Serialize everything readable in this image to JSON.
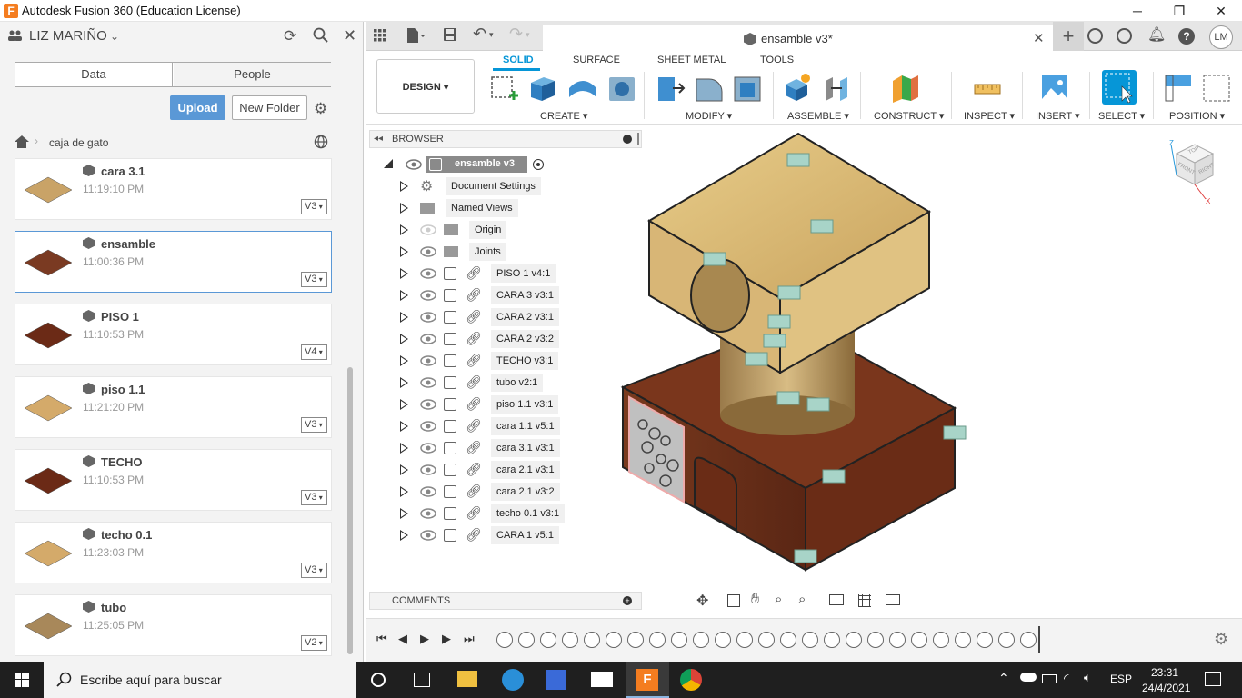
{
  "window": {
    "title": "Autodesk Fusion 360 (Education License)",
    "logo_letter": "F"
  },
  "left_panel": {
    "user": "LIZ MARIÑO",
    "tabs": [
      "Data",
      "People"
    ],
    "upload_label": "Upload",
    "new_folder_label": "New Folder",
    "breadcrumb": "caja de gato",
    "files": [
      {
        "name": "cara 3.1",
        "time": "11:19:10 PM",
        "version": "V3",
        "thumb": "#c9a367"
      },
      {
        "name": "ensamble",
        "time": "11:00:36 PM",
        "version": "V3",
        "thumb": "#7a3a22"
      },
      {
        "name": "PISO 1",
        "time": "11:10:53 PM",
        "version": "V4",
        "thumb": "#6b2a16"
      },
      {
        "name": "piso 1.1",
        "time": "11:21:20 PM",
        "version": "V3",
        "thumb": "#d4aa6a"
      },
      {
        "name": "TECHO",
        "time": "11:10:53 PM",
        "version": "V3",
        "thumb": "#6b2a16"
      },
      {
        "name": "techo 0.1",
        "time": "11:23:03 PM",
        "version": "V3",
        "thumb": "#d4aa6a"
      },
      {
        "name": "tubo",
        "time": "11:25:05 PM",
        "version": "V2",
        "thumb": "#a8885a"
      }
    ]
  },
  "document": {
    "tab_label": "ensamble v3*"
  },
  "toolbar": {
    "design_label": "DESIGN",
    "tabs": [
      "SOLID",
      "SURFACE",
      "SHEET METAL",
      "TOOLS"
    ],
    "groups": [
      "CREATE",
      "MODIFY",
      "ASSEMBLE",
      "CONSTRUCT",
      "INSPECT",
      "INSERT",
      "SELECT",
      "POSITION"
    ],
    "accent": "#0696d7"
  },
  "browser": {
    "title": "BROWSER",
    "root": "ensamble v3",
    "items": [
      "Document Settings",
      "Named Views",
      "Origin",
      "Joints",
      "PISO 1 v4:1",
      "CARA 3 v3:1",
      "CARA 2 v3:1",
      "CARA 2 v3:2",
      "TECHO v3:1",
      "tubo v2:1",
      "piso 1.1 v3:1",
      "cara 1.1 v5:1",
      "cara 3.1 v3:1",
      "cara 2.1 v3:1",
      "cara 2.1 v3:2",
      "techo 0.1 v3:1",
      "CARA 1 v5:1"
    ]
  },
  "comments": {
    "label": "COMMENTS"
  },
  "viewcube": {
    "top": "TOP",
    "front": "FRONT",
    "right": "RIGHT",
    "z": "Z",
    "x": "X"
  },
  "taskbar": {
    "search_placeholder": "Escribe aquí para buscar",
    "lang": "ESP",
    "time": "23:31",
    "date": "24/4/2021"
  }
}
